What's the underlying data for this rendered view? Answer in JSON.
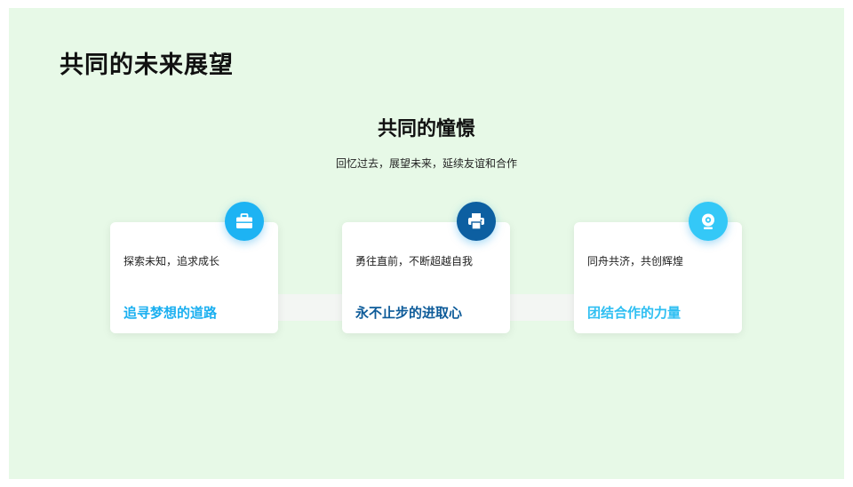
{
  "header": {
    "title": "共同的未来展望"
  },
  "section": {
    "title": "共同的憧憬",
    "subtitle": "回忆过去，展望未来，延续友谊和合作"
  },
  "cards": [
    {
      "description": "探索未知，追求成长",
      "title": "追寻梦想的道路",
      "icon": "briefcase-icon",
      "icon_color": "#1db3f3",
      "title_color": "#1aaff0"
    },
    {
      "description": "勇往直前，不断超越自我",
      "title": "永不止步的进取心",
      "icon": "printer-icon",
      "icon_color": "#0d5fa1",
      "title_color": "#0d5b99"
    },
    {
      "description": "同舟共济，共创辉煌",
      "title": "团结合作的力量",
      "icon": "webcam-icon",
      "icon_color": "#34c8f7",
      "title_color": "#2fbff2"
    }
  ]
}
